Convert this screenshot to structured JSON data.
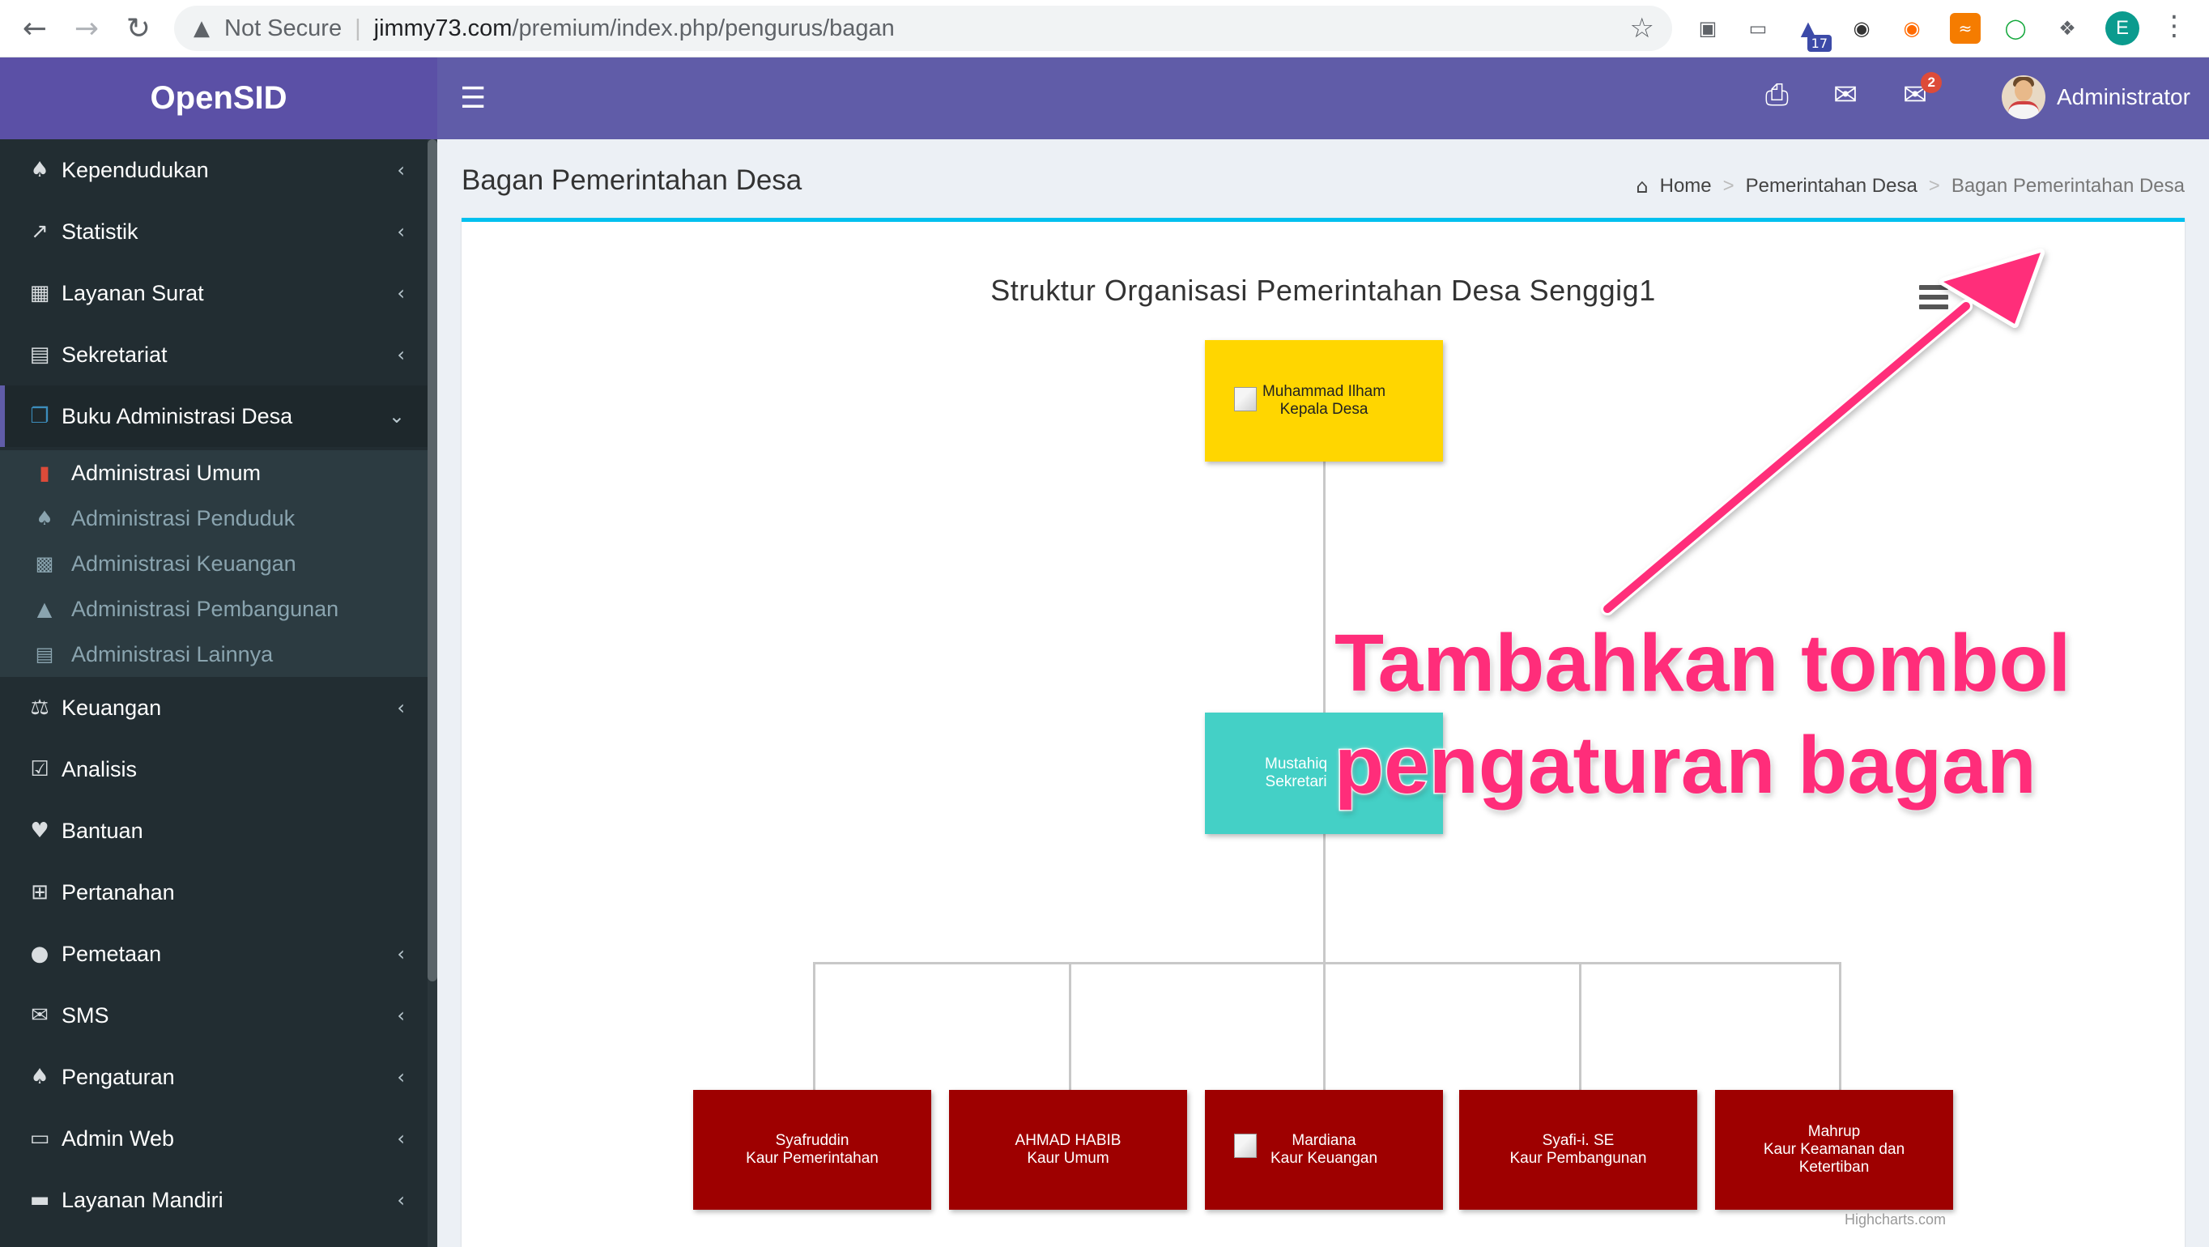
{
  "browser": {
    "security_label": "Not Secure",
    "url_host": "jimmy73.com",
    "url_path": "/premium/index.php/pengurus/bagan",
    "extension_badge": "17",
    "profile_initial": "E"
  },
  "app": {
    "brand": "OpenSID",
    "mail_badge": "2",
    "user_name": "Administrator"
  },
  "sidebar": {
    "items": [
      {
        "label": "Kependudukan",
        "icon": "users-icon"
      },
      {
        "label": "Statistik",
        "icon": "chart-line-icon"
      },
      {
        "label": "Layanan Surat",
        "icon": "book-icon"
      },
      {
        "label": "Sekretariat",
        "icon": "archive-icon"
      },
      {
        "label": "Buku Administrasi Desa",
        "icon": "copy-icon"
      },
      {
        "label": "Keuangan",
        "icon": "balance-scale-icon"
      },
      {
        "label": "Analisis",
        "icon": "check-square-icon"
      },
      {
        "label": "Bantuan",
        "icon": "heart-icon"
      },
      {
        "label": "Pertanahan",
        "icon": "map-signs-icon"
      },
      {
        "label": "Pemetaan",
        "icon": "globe-icon"
      },
      {
        "label": "SMS",
        "icon": "envelope-icon"
      },
      {
        "label": "Pengaturan",
        "icon": "users-cog-icon"
      },
      {
        "label": "Admin Web",
        "icon": "desktop-icon"
      },
      {
        "label": "Layanan Mandiri",
        "icon": "drive-icon"
      }
    ],
    "submenu": [
      {
        "label": "Administrasi Umum",
        "icon": "bookmark-icon"
      },
      {
        "label": "Administrasi Penduduk",
        "icon": "users-icon"
      },
      {
        "label": "Administrasi Keuangan",
        "icon": "money-icon"
      },
      {
        "label": "Administrasi Pembangunan",
        "icon": "institution-icon"
      },
      {
        "label": "Administrasi Lainnya",
        "icon": "archive-icon"
      }
    ]
  },
  "content": {
    "page_title": "Bagan Pemerintahan Desa",
    "breadcrumb": {
      "home": "Home",
      "parent": "Pemerintahan Desa",
      "current": "Bagan Pemerintahan Desa"
    }
  },
  "chart": {
    "title": "Struktur Organisasi Pemerintahan Desa Senggig1",
    "credits": "Highcharts.com",
    "nodes": {
      "kades": {
        "name": "Muhammad Ilham",
        "title": "Kepala Desa"
      },
      "sekdes": {
        "name": "Mustahiq",
        "title": "Sekretari"
      },
      "kaur1": {
        "name": "Syafruddin",
        "title": "Kaur Pemerintahan"
      },
      "kaur2": {
        "name": "AHMAD HABIB",
        "title": "Kaur Umum"
      },
      "kaur3": {
        "name": "Mardiana",
        "title": "Kaur Keuangan"
      },
      "kaur4": {
        "name": "Syafi-i. SE",
        "title": "Kaur Pembangunan"
      },
      "kaur5": {
        "name": "Mahrup",
        "title": "Kaur Keamanan dan Ketertiban"
      }
    }
  },
  "annotation": {
    "line1": "Tambahkan tombol",
    "line2": "pengaturan bagan",
    "color": "#ff2d7a"
  }
}
